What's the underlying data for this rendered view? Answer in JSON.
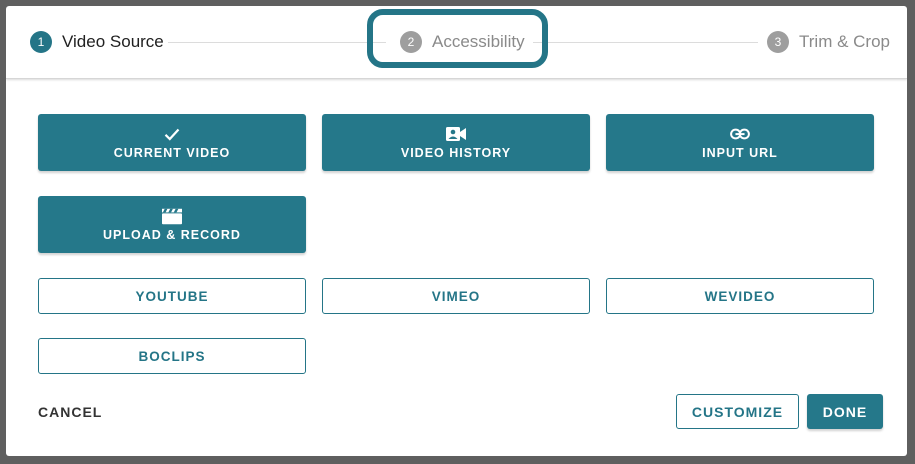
{
  "stepper": {
    "steps": [
      {
        "number": "1",
        "label": "Video Source",
        "state": "active"
      },
      {
        "number": "2",
        "label": "Accessibility",
        "state": "inactive"
      },
      {
        "number": "3",
        "label": "Trim & Crop",
        "state": "inactive"
      }
    ]
  },
  "sources": {
    "filled": [
      {
        "label": "CURRENT VIDEO",
        "icon": "check-icon"
      },
      {
        "label": "VIDEO HISTORY",
        "icon": "video-account-icon"
      },
      {
        "label": "INPUT URL",
        "icon": "link-icon"
      },
      {
        "label": "UPLOAD & RECORD",
        "icon": "clapperboard-icon"
      }
    ],
    "outline": [
      {
        "label": "YOUTUBE"
      },
      {
        "label": "VIMEO"
      },
      {
        "label": "WEVIDEO"
      },
      {
        "label": "BOCLIPS"
      }
    ]
  },
  "footer": {
    "cancel_label": "CANCEL",
    "customize_label": "CUSTOMIZE",
    "done_label": "DONE"
  },
  "colors": {
    "accent": "#247587",
    "inactive_step": "#9e9e9e",
    "backdrop": "#5f5f5f"
  }
}
